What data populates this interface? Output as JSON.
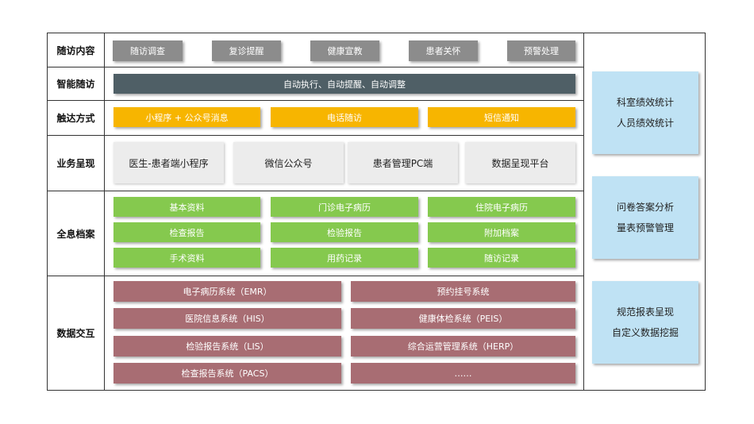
{
  "rows": {
    "followup_content": {
      "label": "随访内容",
      "items": [
        "随访调查",
        "复诊提醒",
        "健康宣教",
        "患者关怀",
        "预警处理"
      ]
    },
    "smart_followup": {
      "label": "智能随访",
      "items": [
        "自动执行、自动提醒、自动调整"
      ]
    },
    "reach_method": {
      "label": "触达方式",
      "items": [
        "小程序 + 公众号消息",
        "电话随访",
        "短信通知"
      ]
    },
    "business_display": {
      "label": "业务呈现",
      "items": [
        "医生-患者端小程序",
        "微信公众号",
        "患者管理PC端",
        "数据呈现平台"
      ]
    },
    "holistic_archive": {
      "label": "全息档案",
      "items": [
        "基本资料",
        "门诊电子病历",
        "住院电子病历",
        "检查报告",
        "检验报告",
        "附加档案",
        "手术资料",
        "用药记录",
        "随访记录"
      ]
    },
    "data_exchange": {
      "label": "数据交互",
      "items": [
        "电子病历系统（EMR）",
        "预约挂号系统",
        "医院信息系统（HIS）",
        "健康体检系统（PEIS）",
        "检验报告系统（LIS）",
        "综合运营管理系统（HERP）",
        "检查报告系统（PACS）",
        "……"
      ]
    }
  },
  "side_panels": [
    {
      "lines": [
        "科室绩效统计",
        "人员绩效统计"
      ]
    },
    {
      "lines": [
        "问卷答案分析",
        "量表预警管理"
      ]
    },
    {
      "lines": [
        "规范报表呈现",
        "自定义数据挖掘"
      ]
    }
  ],
  "colors": {
    "gray_box": "#8c8c8c",
    "dark_bar": "#4f5f66",
    "yellow_box": "#f7b500",
    "light_box": "#ececec",
    "green_box": "#85c94e",
    "red_box": "#a86d73",
    "blue_panel": "#bfe2f4"
  }
}
